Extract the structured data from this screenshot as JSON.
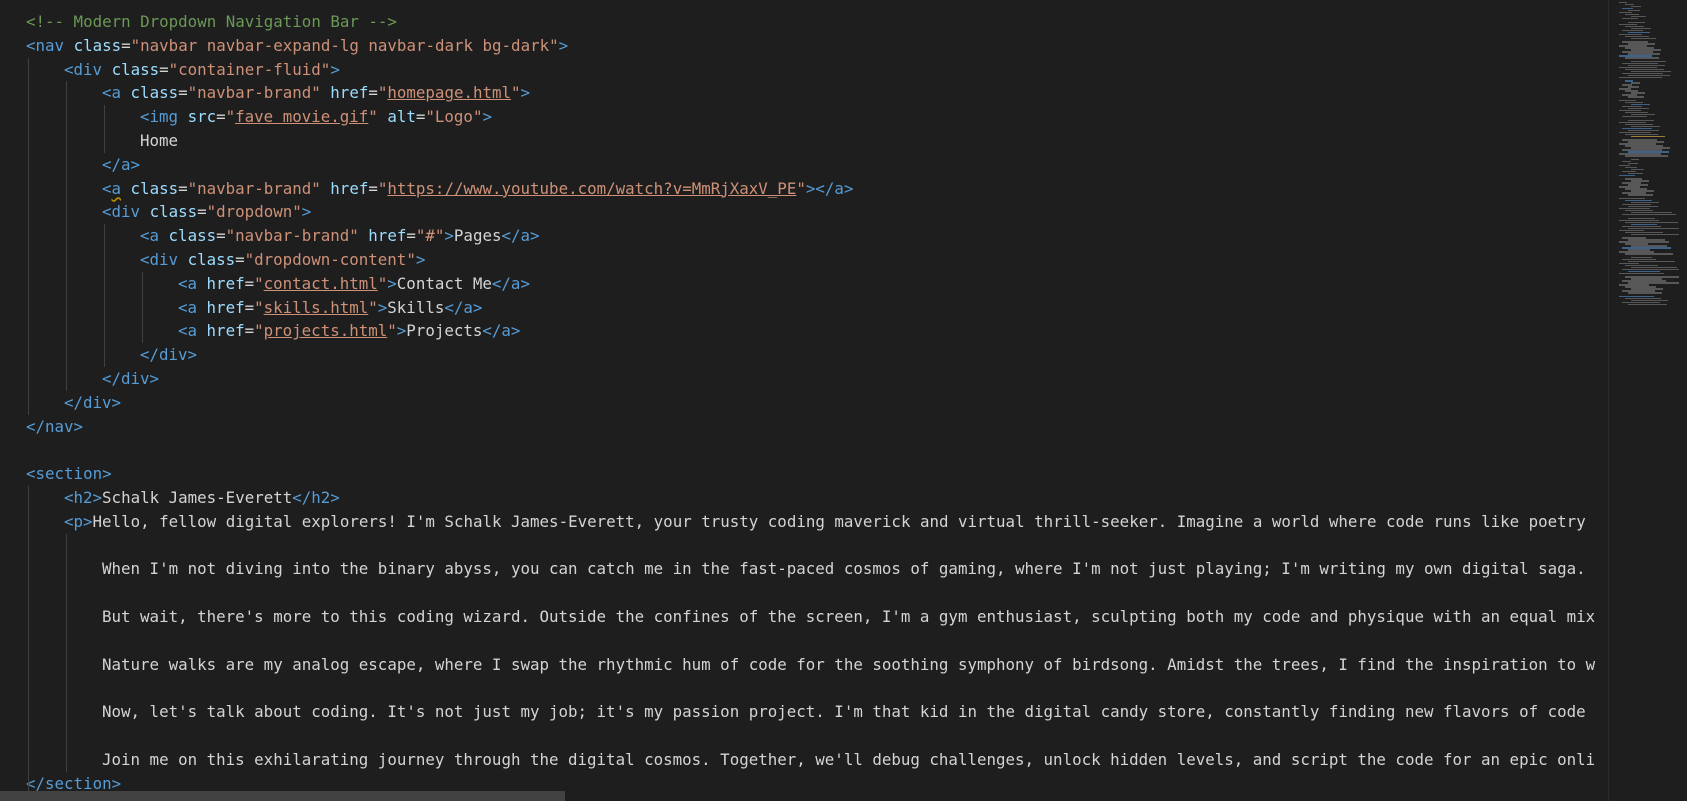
{
  "editor": {
    "language": "html",
    "lines": [
      {
        "indent": 0,
        "tokens": [
          {
            "t": "comment",
            "v": "<!-- Modern Dropdown Navigation Bar -->"
          }
        ]
      },
      {
        "indent": 0,
        "tokens": [
          {
            "t": "tag",
            "v": "<nav"
          },
          {
            "t": "text",
            "v": " "
          },
          {
            "t": "attr",
            "v": "class"
          },
          {
            "t": "text",
            "v": "="
          },
          {
            "t": "str",
            "v": "\"navbar navbar-expand-lg navbar-dark bg-dark\""
          },
          {
            "t": "tag",
            "v": ">"
          }
        ]
      },
      {
        "indent": 1,
        "tokens": [
          {
            "t": "tag",
            "v": "<div"
          },
          {
            "t": "text",
            "v": " "
          },
          {
            "t": "attr",
            "v": "class"
          },
          {
            "t": "text",
            "v": "="
          },
          {
            "t": "str",
            "v": "\"container-fluid\""
          },
          {
            "t": "tag",
            "v": ">"
          }
        ]
      },
      {
        "indent": 2,
        "tokens": [
          {
            "t": "tag",
            "v": "<a"
          },
          {
            "t": "text",
            "v": " "
          },
          {
            "t": "attr",
            "v": "class"
          },
          {
            "t": "text",
            "v": "="
          },
          {
            "t": "str",
            "v": "\"navbar-brand\""
          },
          {
            "t": "text",
            "v": " "
          },
          {
            "t": "attr",
            "v": "href"
          },
          {
            "t": "text",
            "v": "="
          },
          {
            "t": "str",
            "v": "\""
          },
          {
            "t": "link",
            "v": "homepage.html"
          },
          {
            "t": "str",
            "v": "\""
          },
          {
            "t": "tag",
            "v": ">"
          }
        ]
      },
      {
        "indent": 3,
        "tokens": [
          {
            "t": "tag",
            "v": "<img"
          },
          {
            "t": "text",
            "v": " "
          },
          {
            "t": "attr",
            "v": "src"
          },
          {
            "t": "text",
            "v": "="
          },
          {
            "t": "str",
            "v": "\""
          },
          {
            "t": "link",
            "v": "fave movie.gif"
          },
          {
            "t": "str",
            "v": "\""
          },
          {
            "t": "text",
            "v": " "
          },
          {
            "t": "attr",
            "v": "alt"
          },
          {
            "t": "text",
            "v": "="
          },
          {
            "t": "str",
            "v": "\"Logo\""
          },
          {
            "t": "tag",
            "v": ">"
          }
        ]
      },
      {
        "indent": 3,
        "tokens": [
          {
            "t": "text",
            "v": "Home"
          }
        ]
      },
      {
        "indent": 2,
        "tokens": [
          {
            "t": "tag",
            "v": "</a>"
          }
        ]
      },
      {
        "indent": 2,
        "tokens": [
          {
            "t": "tag",
            "v": "<"
          },
          {
            "t": "tagsq",
            "v": "a"
          },
          {
            "t": "text",
            "v": " "
          },
          {
            "t": "attr",
            "v": "class"
          },
          {
            "t": "text",
            "v": "="
          },
          {
            "t": "str",
            "v": "\"navbar-brand\""
          },
          {
            "t": "text",
            "v": " "
          },
          {
            "t": "attr",
            "v": "href"
          },
          {
            "t": "text",
            "v": "="
          },
          {
            "t": "str",
            "v": "\""
          },
          {
            "t": "link",
            "v": "https://www.youtube.com/watch?v=MmRjXaxV_PE"
          },
          {
            "t": "str",
            "v": "\""
          },
          {
            "t": "tag",
            "v": "></a>"
          }
        ]
      },
      {
        "indent": 2,
        "tokens": [
          {
            "t": "tag",
            "v": "<div"
          },
          {
            "t": "text",
            "v": " "
          },
          {
            "t": "attr",
            "v": "class"
          },
          {
            "t": "text",
            "v": "="
          },
          {
            "t": "str",
            "v": "\"dropdown\""
          },
          {
            "t": "tag",
            "v": ">"
          }
        ]
      },
      {
        "indent": 3,
        "tokens": [
          {
            "t": "tag",
            "v": "<a"
          },
          {
            "t": "text",
            "v": " "
          },
          {
            "t": "attr",
            "v": "class"
          },
          {
            "t": "text",
            "v": "="
          },
          {
            "t": "str",
            "v": "\"navbar-brand\""
          },
          {
            "t": "text",
            "v": " "
          },
          {
            "t": "attr",
            "v": "href"
          },
          {
            "t": "text",
            "v": "="
          },
          {
            "t": "str",
            "v": "\"#\""
          },
          {
            "t": "tag",
            "v": ">"
          },
          {
            "t": "text",
            "v": "Pages"
          },
          {
            "t": "tag",
            "v": "</a>"
          }
        ]
      },
      {
        "indent": 3,
        "tokens": [
          {
            "t": "tag",
            "v": "<div"
          },
          {
            "t": "text",
            "v": " "
          },
          {
            "t": "attr",
            "v": "class"
          },
          {
            "t": "text",
            "v": "="
          },
          {
            "t": "str",
            "v": "\"dropdown-content\""
          },
          {
            "t": "tag",
            "v": ">"
          }
        ]
      },
      {
        "indent": 4,
        "tokens": [
          {
            "t": "tag",
            "v": "<a"
          },
          {
            "t": "text",
            "v": " "
          },
          {
            "t": "attr",
            "v": "href"
          },
          {
            "t": "text",
            "v": "="
          },
          {
            "t": "str",
            "v": "\""
          },
          {
            "t": "link",
            "v": "contact.html"
          },
          {
            "t": "str",
            "v": "\""
          },
          {
            "t": "tag",
            "v": ">"
          },
          {
            "t": "text",
            "v": "Contact Me"
          },
          {
            "t": "tag",
            "v": "</a>"
          }
        ]
      },
      {
        "indent": 4,
        "tokens": [
          {
            "t": "tag",
            "v": "<a"
          },
          {
            "t": "text",
            "v": " "
          },
          {
            "t": "attr",
            "v": "href"
          },
          {
            "t": "text",
            "v": "="
          },
          {
            "t": "str",
            "v": "\""
          },
          {
            "t": "link",
            "v": "skills.html"
          },
          {
            "t": "str",
            "v": "\""
          },
          {
            "t": "tag",
            "v": ">"
          },
          {
            "t": "text",
            "v": "Skills"
          },
          {
            "t": "tag",
            "v": "</a>"
          }
        ]
      },
      {
        "indent": 4,
        "tokens": [
          {
            "t": "tag",
            "v": "<a"
          },
          {
            "t": "text",
            "v": " "
          },
          {
            "t": "attr",
            "v": "href"
          },
          {
            "t": "text",
            "v": "="
          },
          {
            "t": "str",
            "v": "\""
          },
          {
            "t": "link",
            "v": "projects.html"
          },
          {
            "t": "str",
            "v": "\""
          },
          {
            "t": "tag",
            "v": ">"
          },
          {
            "t": "text",
            "v": "Projects"
          },
          {
            "t": "tag",
            "v": "</a>"
          }
        ]
      },
      {
        "indent": 3,
        "tokens": [
          {
            "t": "tag",
            "v": "</div>"
          }
        ]
      },
      {
        "indent": 2,
        "tokens": [
          {
            "t": "tag",
            "v": "</div>"
          }
        ]
      },
      {
        "indent": 1,
        "tokens": [
          {
            "t": "tag",
            "v": "</div>"
          }
        ]
      },
      {
        "indent": 0,
        "tokens": [
          {
            "t": "tag",
            "v": "</nav>"
          }
        ]
      },
      {
        "indent": 0,
        "tokens": []
      },
      {
        "indent": 0,
        "tokens": [
          {
            "t": "tag",
            "v": "<section>"
          }
        ]
      },
      {
        "indent": 1,
        "tokens": [
          {
            "t": "tag",
            "v": "<h2>"
          },
          {
            "t": "text",
            "v": "Schalk James-Everett"
          },
          {
            "t": "tag",
            "v": "</h2>"
          }
        ]
      },
      {
        "indent": 1,
        "tokens": [
          {
            "t": "tag",
            "v": "<p>"
          },
          {
            "t": "text",
            "v": "Hello, fellow digital explorers! I'm Schalk James-Everett, your trusty coding maverick and virtual thrill-seeker. Imagine a world where code runs like poetry"
          }
        ]
      },
      {
        "indent": 0,
        "tokens": []
      },
      {
        "indent": 2,
        "tokens": [
          {
            "t": "text",
            "v": "When I'm not diving into the binary abyss, you can catch me in the fast-paced cosmos of gaming, where I'm not just playing; I'm writing my own digital saga."
          }
        ]
      },
      {
        "indent": 0,
        "tokens": []
      },
      {
        "indent": 2,
        "tokens": [
          {
            "t": "text",
            "v": "But wait, there's more to this coding wizard. Outside the confines of the screen, I'm a gym enthusiast, sculpting both my code and physique with an equal mix"
          }
        ]
      },
      {
        "indent": 0,
        "tokens": []
      },
      {
        "indent": 2,
        "tokens": [
          {
            "t": "text",
            "v": "Nature walks are my analog escape, where I swap the rhythmic hum of code for the soothing symphony of birdsong. Amidst the trees, I find the inspiration to w"
          }
        ]
      },
      {
        "indent": 0,
        "tokens": []
      },
      {
        "indent": 2,
        "tokens": [
          {
            "t": "text",
            "v": "Now, let's talk about coding. It's not just my job; it's my passion project. I'm that kid in the digital candy store, constantly finding new flavors of code"
          }
        ]
      },
      {
        "indent": 0,
        "tokens": []
      },
      {
        "indent": 2,
        "tokens": [
          {
            "t": "text",
            "v": "Join me on this exhilarating journey through the digital cosmos. Together, we'll debug challenges, unlock hidden levels, and script the code for an epic onli"
          }
        ]
      },
      {
        "indent": 0,
        "tokens": [
          {
            "t": "tag",
            "v": "</section>"
          }
        ]
      }
    ]
  },
  "colors": {
    "background": "#1e1e1e",
    "tag": "#569cd6",
    "attribute": "#9cdcfe",
    "string": "#ce9178",
    "comment": "#6a9955",
    "text": "#d4d4d4",
    "indent_guide": "#404040",
    "scrollbar_thumb": "#424242"
  }
}
